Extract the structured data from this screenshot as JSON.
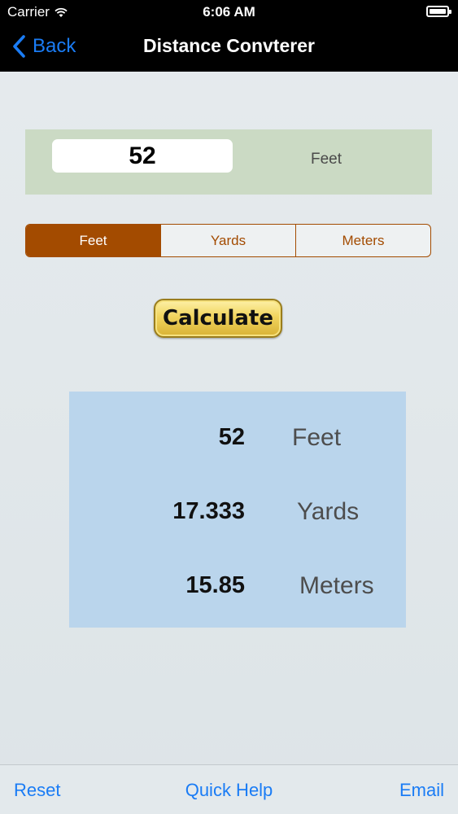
{
  "status_bar": {
    "carrier": "Carrier",
    "time": "6:06 AM"
  },
  "nav": {
    "back_label": "Back",
    "title": "Distance Convterer"
  },
  "input": {
    "value": "52",
    "unit": "Feet"
  },
  "units": [
    "Feet",
    "Yards",
    "Meters"
  ],
  "selected_unit": "Feet",
  "calculate_label": "Calculate",
  "results": [
    {
      "value": "52",
      "unit": "Feet"
    },
    {
      "value": "17.333",
      "unit": "Yards"
    },
    {
      "value": "15.85",
      "unit": "Meters"
    }
  ],
  "toolbar": {
    "reset": "Reset",
    "quick_help": "Quick Help",
    "email": "Email"
  },
  "colors": {
    "accent": "#1a7cf5",
    "segment": "#a34b00",
    "input_panel": "#cbdac4",
    "results_panel": "#bad5ec",
    "button_gold": "#f1d45e"
  },
  "icons": {
    "wifi": "wifi-icon",
    "battery": "battery-icon",
    "back": "chevron-left-icon"
  }
}
